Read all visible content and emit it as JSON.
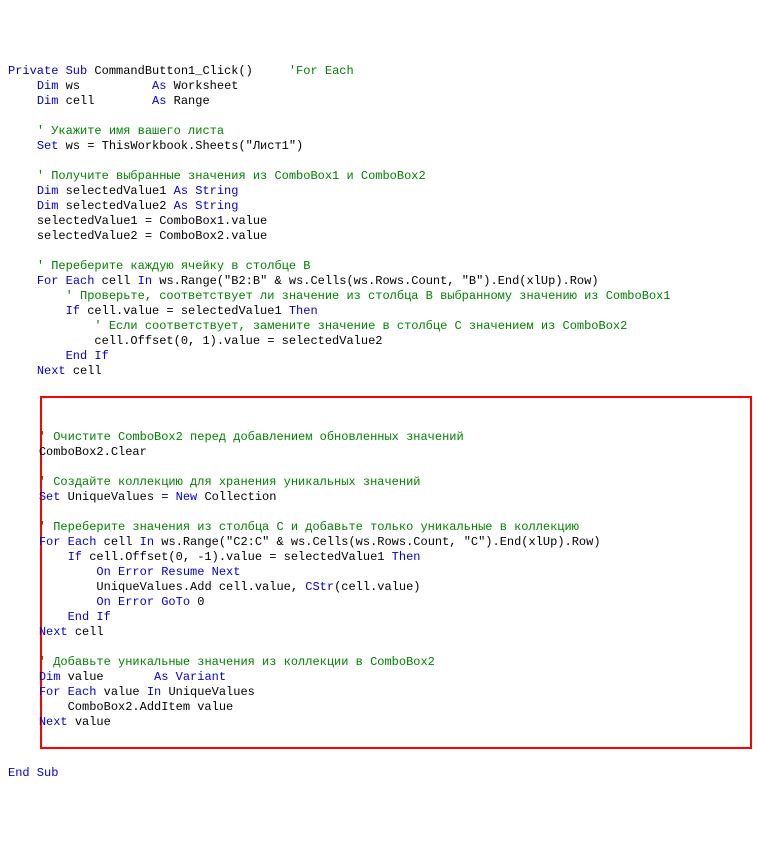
{
  "lines": [
    {
      "indent": 0,
      "segs": [
        {
          "c": "kw",
          "t": "Private Sub"
        },
        {
          "t": " CommandButton1_Click()     "
        },
        {
          "c": "cm",
          "t": "'For Each"
        }
      ]
    },
    {
      "indent": 1,
      "segs": [
        {
          "c": "kw",
          "t": "Dim"
        },
        {
          "t": " ws          "
        },
        {
          "c": "kw",
          "t": "As"
        },
        {
          "t": " Worksheet"
        }
      ]
    },
    {
      "indent": 1,
      "segs": [
        {
          "c": "kw",
          "t": "Dim"
        },
        {
          "t": " cell        "
        },
        {
          "c": "kw",
          "t": "As"
        },
        {
          "t": " Range"
        }
      ]
    },
    {
      "indent": 0,
      "segs": [
        {
          "t": ""
        }
      ]
    },
    {
      "indent": 1,
      "segs": [
        {
          "c": "cm",
          "t": "' Укажите имя вашего листа"
        }
      ]
    },
    {
      "indent": 1,
      "segs": [
        {
          "c": "kw",
          "t": "Set"
        },
        {
          "t": " ws = ThisWorkbook.Sheets(\"Лист1\")"
        }
      ]
    },
    {
      "indent": 0,
      "segs": [
        {
          "t": ""
        }
      ]
    },
    {
      "indent": 1,
      "segs": [
        {
          "c": "cm",
          "t": "' Получите выбранные значения из ComboBox1 и ComboBox2"
        }
      ]
    },
    {
      "indent": 1,
      "segs": [
        {
          "c": "kw",
          "t": "Dim"
        },
        {
          "t": " selectedValue1 "
        },
        {
          "c": "kw",
          "t": "As String"
        }
      ]
    },
    {
      "indent": 1,
      "segs": [
        {
          "c": "kw",
          "t": "Dim"
        },
        {
          "t": " selectedValue2 "
        },
        {
          "c": "kw",
          "t": "As String"
        }
      ]
    },
    {
      "indent": 1,
      "segs": [
        {
          "t": "selectedValue1 = ComboBox1.value"
        }
      ]
    },
    {
      "indent": 1,
      "segs": [
        {
          "t": "selectedValue2 = ComboBox2.value"
        }
      ]
    },
    {
      "indent": 0,
      "segs": [
        {
          "t": ""
        }
      ]
    },
    {
      "indent": 1,
      "segs": [
        {
          "c": "cm",
          "t": "' Переберите каждую ячейку в столбце B"
        }
      ]
    },
    {
      "indent": 1,
      "segs": [
        {
          "c": "kw",
          "t": "For Each"
        },
        {
          "t": " cell "
        },
        {
          "c": "kw",
          "t": "In"
        },
        {
          "t": " ws.Range(\"B2:B\" & ws.Cells(ws.Rows.Count, \"B\").End(xlUp).Row)"
        }
      ]
    },
    {
      "indent": 2,
      "segs": [
        {
          "c": "cm",
          "t": "' Проверьте, соответствует ли значение из столбца B выбранному значению из ComboBox1"
        }
      ]
    },
    {
      "indent": 2,
      "segs": [
        {
          "c": "kw",
          "t": "If"
        },
        {
          "t": " cell.value = selectedValue1 "
        },
        {
          "c": "kw",
          "t": "Then"
        }
      ]
    },
    {
      "indent": 3,
      "segs": [
        {
          "c": "cm",
          "t": "' Если соответствует, замените значение в столбце C значением из ComboBox2"
        }
      ]
    },
    {
      "indent": 3,
      "segs": [
        {
          "t": "cell.Offset(0, 1).value = selectedValue2"
        }
      ]
    },
    {
      "indent": 2,
      "segs": [
        {
          "c": "kw",
          "t": "End If"
        }
      ]
    },
    {
      "indent": 1,
      "segs": [
        {
          "c": "kw",
          "t": "Next"
        },
        {
          "t": " cell"
        }
      ]
    }
  ],
  "boxed": [
    {
      "indent": 1,
      "segs": [
        {
          "c": "cm",
          "t": "' Очистите ComboBox2 перед добавлением обновленных значений"
        }
      ]
    },
    {
      "indent": 1,
      "segs": [
        {
          "t": "ComboBox2.Clear"
        }
      ]
    },
    {
      "indent": 0,
      "segs": [
        {
          "t": ""
        }
      ]
    },
    {
      "indent": 1,
      "segs": [
        {
          "c": "cm",
          "t": "' Создайте коллекцию для хранения уникальных значений"
        }
      ]
    },
    {
      "indent": 1,
      "segs": [
        {
          "c": "kw",
          "t": "Set"
        },
        {
          "t": " UniqueValues = "
        },
        {
          "c": "kw",
          "t": "New"
        },
        {
          "t": " Collection"
        }
      ]
    },
    {
      "indent": 0,
      "segs": [
        {
          "t": ""
        }
      ]
    },
    {
      "indent": 1,
      "segs": [
        {
          "c": "cm",
          "t": "' Переберите значения из столбца C и добавьте только уникальные в коллекцию"
        }
      ]
    },
    {
      "indent": 1,
      "segs": [
        {
          "c": "kw",
          "t": "For Each"
        },
        {
          "t": " cell "
        },
        {
          "c": "kw",
          "t": "In"
        },
        {
          "t": " ws.Range(\"C2:C\" & ws.Cells(ws.Rows.Count, \"C\").End(xlUp).Row)"
        }
      ]
    },
    {
      "indent": 2,
      "segs": [
        {
          "c": "kw",
          "t": "If"
        },
        {
          "t": " cell.Offset(0, -1).value = selectedValue1 "
        },
        {
          "c": "kw",
          "t": "Then"
        }
      ]
    },
    {
      "indent": 3,
      "segs": [
        {
          "c": "kw",
          "t": "On Error Resume Next"
        }
      ]
    },
    {
      "indent": 3,
      "segs": [
        {
          "t": "UniqueValues.Add cell.value, "
        },
        {
          "c": "kw",
          "t": "CStr"
        },
        {
          "t": "(cell.value)"
        }
      ]
    },
    {
      "indent": 3,
      "segs": [
        {
          "c": "kw",
          "t": "On Error GoTo"
        },
        {
          "t": " 0"
        }
      ]
    },
    {
      "indent": 2,
      "segs": [
        {
          "c": "kw",
          "t": "End If"
        }
      ]
    },
    {
      "indent": 1,
      "segs": [
        {
          "c": "kw",
          "t": "Next"
        },
        {
          "t": " cell"
        }
      ]
    },
    {
      "indent": 0,
      "segs": [
        {
          "t": ""
        }
      ]
    },
    {
      "indent": 1,
      "segs": [
        {
          "c": "cm",
          "t": "' Добавьте уникальные значения из коллекции в ComboBox2"
        }
      ]
    },
    {
      "indent": 1,
      "segs": [
        {
          "c": "kw",
          "t": "Dim"
        },
        {
          "t": " value       "
        },
        {
          "c": "kw",
          "t": "As Variant"
        }
      ]
    },
    {
      "indent": 1,
      "segs": [
        {
          "c": "kw",
          "t": "For Each"
        },
        {
          "t": " value "
        },
        {
          "c": "kw",
          "t": "In"
        },
        {
          "t": " UniqueValues"
        }
      ]
    },
    {
      "indent": 2,
      "segs": [
        {
          "t": "ComboBox2.AddItem value"
        }
      ]
    },
    {
      "indent": 1,
      "segs": [
        {
          "c": "kw",
          "t": "Next"
        },
        {
          "t": " value"
        }
      ]
    }
  ],
  "after": [
    {
      "indent": 0,
      "segs": [
        {
          "c": "kw",
          "t": "End Sub"
        }
      ]
    }
  ],
  "indent_unit": "    "
}
